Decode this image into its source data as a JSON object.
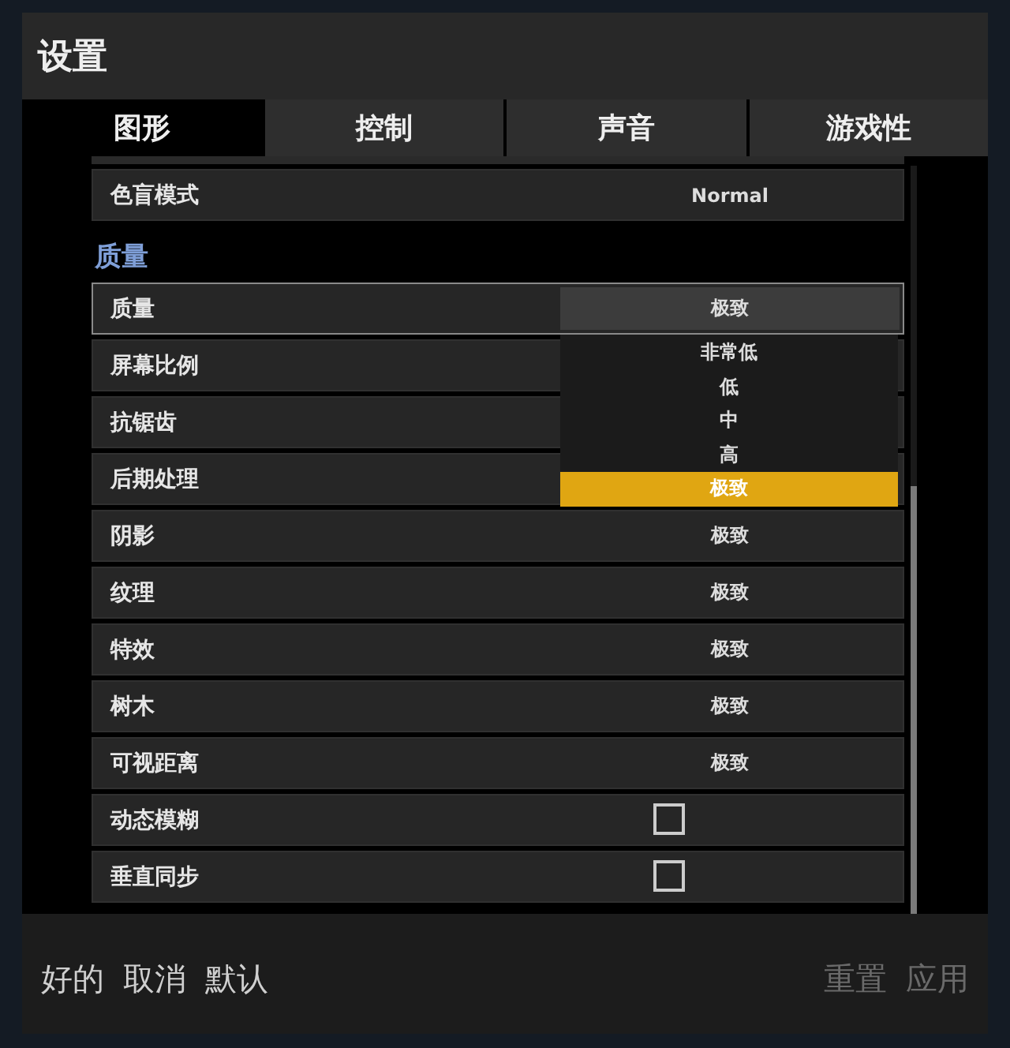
{
  "window": {
    "title": "设置"
  },
  "tabs": [
    {
      "label": "图形",
      "selected": true
    },
    {
      "label": "控制",
      "selected": false
    },
    {
      "label": "声音",
      "selected": false
    },
    {
      "label": "游戏性",
      "selected": false
    }
  ],
  "top_rows": [
    {
      "kind": "select",
      "label": "色盲模式",
      "value": "Normal"
    }
  ],
  "section": {
    "heading": "质量"
  },
  "rows": [
    {
      "kind": "select",
      "label": "质量",
      "value": "极致",
      "expanded": true,
      "options": [
        {
          "label": "非常低",
          "selected": false
        },
        {
          "label": "低",
          "selected": false
        },
        {
          "label": "中",
          "selected": false
        },
        {
          "label": "高",
          "selected": false
        },
        {
          "label": "极致",
          "selected": true
        }
      ]
    },
    {
      "kind": "select",
      "label": "屏幕比例"
    },
    {
      "kind": "select",
      "label": "抗锯齿"
    },
    {
      "kind": "select",
      "label": "后期处理"
    },
    {
      "kind": "select",
      "label": "阴影",
      "value": "极致"
    },
    {
      "kind": "select",
      "label": "纹理",
      "value": "极致"
    },
    {
      "kind": "select",
      "label": "特效",
      "value": "极致"
    },
    {
      "kind": "select",
      "label": "树木",
      "value": "极致"
    },
    {
      "kind": "select",
      "label": "可视距离",
      "value": "极致"
    },
    {
      "kind": "checkbox",
      "label": "动态模糊",
      "checked": false
    },
    {
      "kind": "checkbox",
      "label": "垂直同步",
      "checked": false
    }
  ],
  "footer": {
    "left_buttons": [
      {
        "label": "好的",
        "disabled": false
      },
      {
        "label": "取消",
        "disabled": false
      },
      {
        "label": "默认",
        "disabled": false
      }
    ],
    "right_buttons": [
      {
        "label": "重置",
        "disabled": true
      },
      {
        "label": "应用",
        "disabled": true
      }
    ]
  }
}
